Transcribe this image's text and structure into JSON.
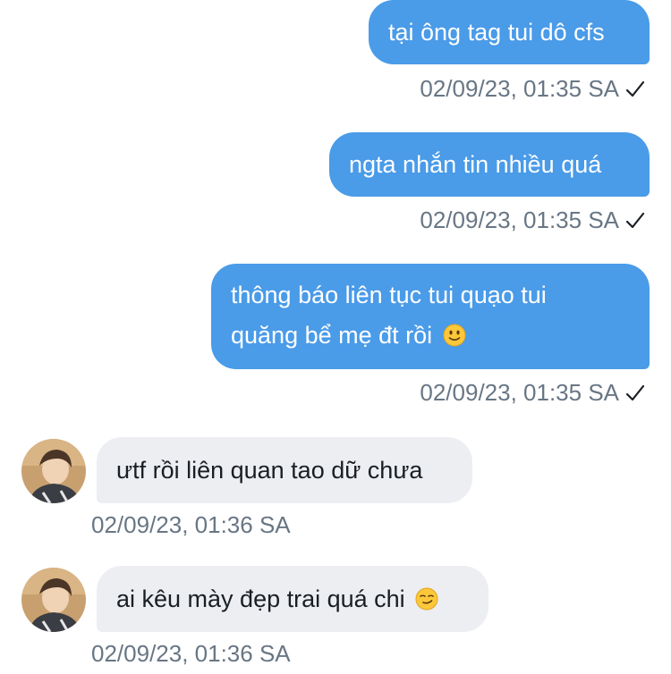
{
  "messages": [
    {
      "direction": "outgoing",
      "text": "tại ông tag tui dô cfs",
      "time": "02/09/23, 01:35 SA",
      "status_icon": "check-icon"
    },
    {
      "direction": "outgoing",
      "text": "ngta nhắn tin nhiều quá",
      "time": "02/09/23, 01:35 SA",
      "status_icon": "check-icon"
    },
    {
      "direction": "outgoing",
      "lines": [
        "thông báo liên tục tui quạo tui",
        "quăng bể mẹ đt rồi"
      ],
      "emoji": "slightly-smiling-face-emoji",
      "time": "02/09/23, 01:35 SA",
      "status_icon": "check-icon"
    },
    {
      "direction": "incoming",
      "text": "ưtf rồi liên quan tao dữ chưa",
      "time": "02/09/23, 01:36 SA",
      "avatar": "user-avatar"
    },
    {
      "direction": "incoming",
      "text": "ai kêu mày đẹp trai quá chi",
      "emoji": "smirking-face-emoji",
      "time": "02/09/23, 01:36 SA",
      "avatar": "user-avatar"
    }
  ],
  "colors": {
    "outgoing_bubble": "#4a9be8",
    "incoming_bubble": "#eceef2",
    "timestamp": "#687684",
    "incoming_text": "#1a1f24"
  }
}
